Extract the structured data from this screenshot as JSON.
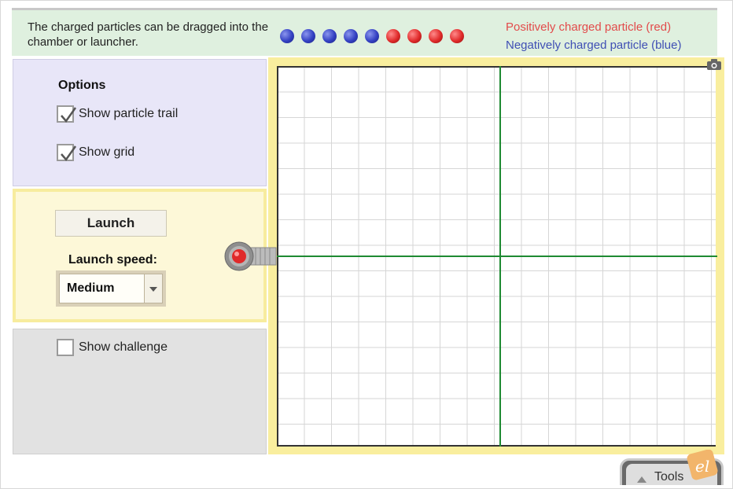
{
  "header": {
    "instructions": "The charged particles can be dragged into the chamber or launcher.",
    "legend_positive": "Positively charged particle (red)",
    "legend_negative": "Negatively charged particle (blue)",
    "particle_colors": {
      "positive": "#e02a2a",
      "negative": "#3340c2"
    }
  },
  "options": {
    "title": "Options",
    "show_trail_label": "Show particle trail",
    "show_trail_checked": true,
    "show_grid_label": "Show grid",
    "show_grid_checked": true
  },
  "launch": {
    "button_label": "Launch",
    "speed_label": "Launch speed:",
    "speed_value": "Medium"
  },
  "challenge": {
    "show_challenge_label": "Show challenge",
    "checked": false
  },
  "tools": {
    "label": "Tools"
  },
  "logo_text": "el",
  "colors": {
    "axis": "#1e8a32",
    "chamber_border": "#f9ee9e",
    "topbar_bg": "#dff0df",
    "options_bg": "#e8e6f8",
    "launch_bg": "#fdf8d8",
    "challenge_bg": "#e2e2e2"
  }
}
